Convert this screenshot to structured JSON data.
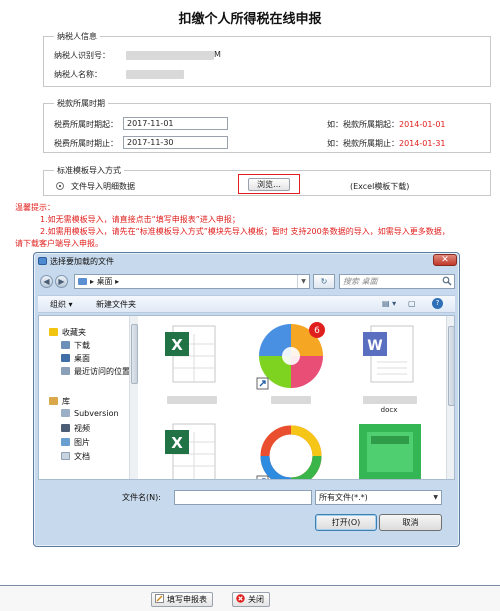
{
  "page_title": "扣缴个人所得税在线申报",
  "taxpayer": {
    "legend": "纳税人信息",
    "id_label": "纳税人识别号：",
    "id_suffix": "M",
    "name_label": "纳税人名称："
  },
  "period": {
    "legend": "税款所属时期",
    "start_label": "税费所属时期起：",
    "start_value": "2017-11-01",
    "end_label": "税费所属时期止：",
    "end_value": "2017-11-30",
    "start_hint_prefix": "如：税款所属期起：",
    "start_hint_example": "2014-01-01",
    "end_hint_prefix": "如：税款所属期止：",
    "end_hint_example": "2014-01-31"
  },
  "import": {
    "legend": "标准模板导入方式",
    "radio_label": "文件导入明细数据",
    "browse_label": "浏览…",
    "template_link": "(Excel模板下载)"
  },
  "tips": {
    "title": "温馨提示：",
    "line1": "1.如无需模板导入，请直接点击“填写申报表”进入申报；",
    "line2a": "2.如需用模板导入，请先在“标准模板导入方式”模块先导入模板；暂时 支持200条数据的导入，如需导入更多数据，",
    "line2b": "请下载客户端导入申报。"
  },
  "dialog": {
    "title": "选择要加载的文件",
    "address": "桌面",
    "search_placeholder": "搜索 桌面",
    "toolbar": {
      "organize": "组织 ▾",
      "new_folder": "新建文件夹"
    },
    "nav": {
      "favorites_header": "收藏夹",
      "favorites": [
        "下载",
        "桌面",
        "最近访问的位置"
      ],
      "library_header": "库",
      "libraries": [
        "Subversion",
        "视频",
        "图片",
        "文档"
      ]
    },
    "files": [
      {
        "label": "",
        "kind": "excel"
      },
      {
        "label": "",
        "kind": "app-colorful"
      },
      {
        "label": "",
        "kind": "word"
      },
      {
        "label": "",
        "kind": "excel"
      },
      {
        "label": "",
        "kind": "app-ring"
      },
      {
        "label": "",
        "kind": "green"
      }
    ],
    "partial_label_docx": "docx",
    "badge_count": "6",
    "filename_label": "文件名(N):",
    "filename_value": "",
    "filetype_value": "所有文件(*.*)",
    "open_button": "打开(O)",
    "cancel_button": "取消"
  },
  "footer": {
    "fill_button": "填写申报表",
    "close_button": "关闭"
  },
  "colors": {
    "accent_red": "#e0201e",
    "dialog_frame": "#c7d9ec"
  }
}
